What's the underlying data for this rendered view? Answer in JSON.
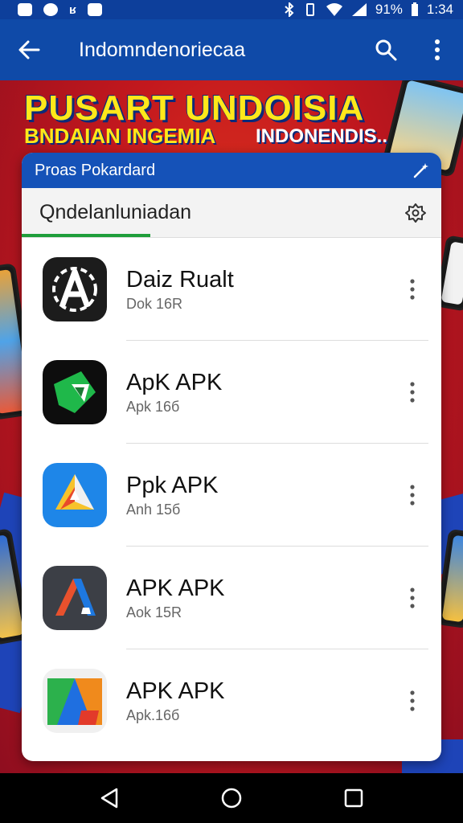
{
  "status": {
    "carrier_text": "ʁ",
    "battery_pct": "91%",
    "time": "1:34"
  },
  "appbar": {
    "title": "Indomndenoriecaa"
  },
  "banner": {
    "headline": "PUSART UNDOISIA",
    "subtitle_left": "BNDAIAN INGEMIA",
    "subtitle_right": "INDONENDIS.."
  },
  "card": {
    "header_title": "Proas Pokardard",
    "search_value": "Qndelanluniadan"
  },
  "apps": [
    {
      "name": "Daiz Rualt",
      "size": "Dok 16R"
    },
    {
      "name": "ApK APK",
      "size": "Apk 16б"
    },
    {
      "name": "Ppk APK",
      "size": "Anh 15б"
    },
    {
      "name": "APK APK",
      "size": "Aok 15R"
    },
    {
      "name": "APK APK",
      "size": "Apk.16б"
    }
  ],
  "colors": {
    "appbar": "#0f4aa8",
    "banner_red": "#c3181e",
    "headline_yellow": "#ffe81a",
    "progress_green": "#1f9e3a"
  }
}
